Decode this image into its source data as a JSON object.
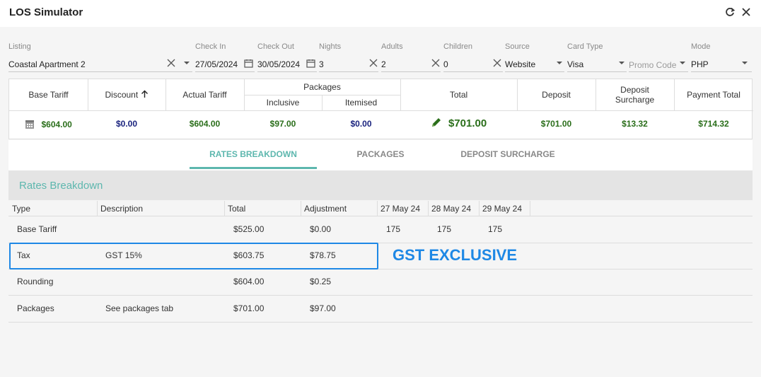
{
  "window": {
    "title": "LOS Simulator"
  },
  "filters": {
    "listing": {
      "label": "Listing",
      "value": "Coastal Apartment 2"
    },
    "check_in": {
      "label": "Check In",
      "value": "27/05/2024"
    },
    "check_out": {
      "label": "Check Out",
      "value": "30/05/2024"
    },
    "nights": {
      "label": "Nights",
      "value": "3"
    },
    "adults": {
      "label": "Adults",
      "value": "2"
    },
    "children": {
      "label": "Children",
      "value": "0"
    },
    "source": {
      "label": "Source",
      "value": "Website"
    },
    "card_type": {
      "label": "Card Type",
      "value": "Visa"
    },
    "promo_code": {
      "placeholder": "Promo Code"
    },
    "mode": {
      "label": "Mode",
      "value": "PHP"
    }
  },
  "summary": {
    "headers": {
      "base_tariff": "Base Tariff",
      "discount": "Discount",
      "actual_tariff": "Actual Tariff",
      "packages": "Packages",
      "inclusive": "Inclusive",
      "itemised": "Itemised",
      "total": "Total",
      "deposit": "Deposit",
      "deposit_surcharge_line1": "Deposit",
      "deposit_surcharge_line2": "Surcharge",
      "payment_total": "Payment Total"
    },
    "values": {
      "base_tariff": "$604.00",
      "discount": "$0.00",
      "actual_tariff": "$604.00",
      "inclusive": "$97.00",
      "itemised": "$0.00",
      "total": "$701.00",
      "deposit": "$701.00",
      "deposit_surcharge": "$13.32",
      "payment_total": "$714.32"
    }
  },
  "tabs": [
    {
      "label": "RATES BREAKDOWN",
      "active": true
    },
    {
      "label": "PACKAGES",
      "active": false
    },
    {
      "label": "DEPOSIT SURCHARGE",
      "active": false
    }
  ],
  "rates_breakdown": {
    "title": "Rates Breakdown",
    "columns": [
      "Type",
      "Description",
      "Total",
      "Adjustment",
      "27 May 24",
      "28 May 24",
      "29 May 24"
    ],
    "rows": [
      {
        "type": "Base Tariff",
        "description": "",
        "total": "$525.00",
        "adjustment": "$0.00",
        "d1": "175",
        "d2": "175",
        "d3": "175"
      },
      {
        "type": "Tax",
        "description": "GST 15%",
        "total": "$603.75",
        "adjustment": "$78.75",
        "d1": "",
        "d2": "",
        "d3": ""
      },
      {
        "type": "Rounding",
        "description": "",
        "total": "$604.00",
        "adjustment": "$0.25",
        "d1": "",
        "d2": "",
        "d3": ""
      },
      {
        "type": "Packages",
        "description": "See packages tab",
        "total": "$701.00",
        "adjustment": "$97.00",
        "d1": "",
        "d2": "",
        "d3": ""
      }
    ]
  },
  "annotation": {
    "text": "GST EXCLUSIVE",
    "color": "#1e88e5"
  },
  "colors": {
    "accent": "#5db7ae",
    "value_green": "#2a6e1a",
    "value_navy": "#1a237e"
  },
  "icons": {
    "refresh": "refresh-icon",
    "close": "close-icon",
    "calendar": "calendar-icon",
    "clear": "clear-icon",
    "dropdown": "chevron-down-icon",
    "edit": "pencil-icon",
    "sort": "arrow-up-icon"
  }
}
